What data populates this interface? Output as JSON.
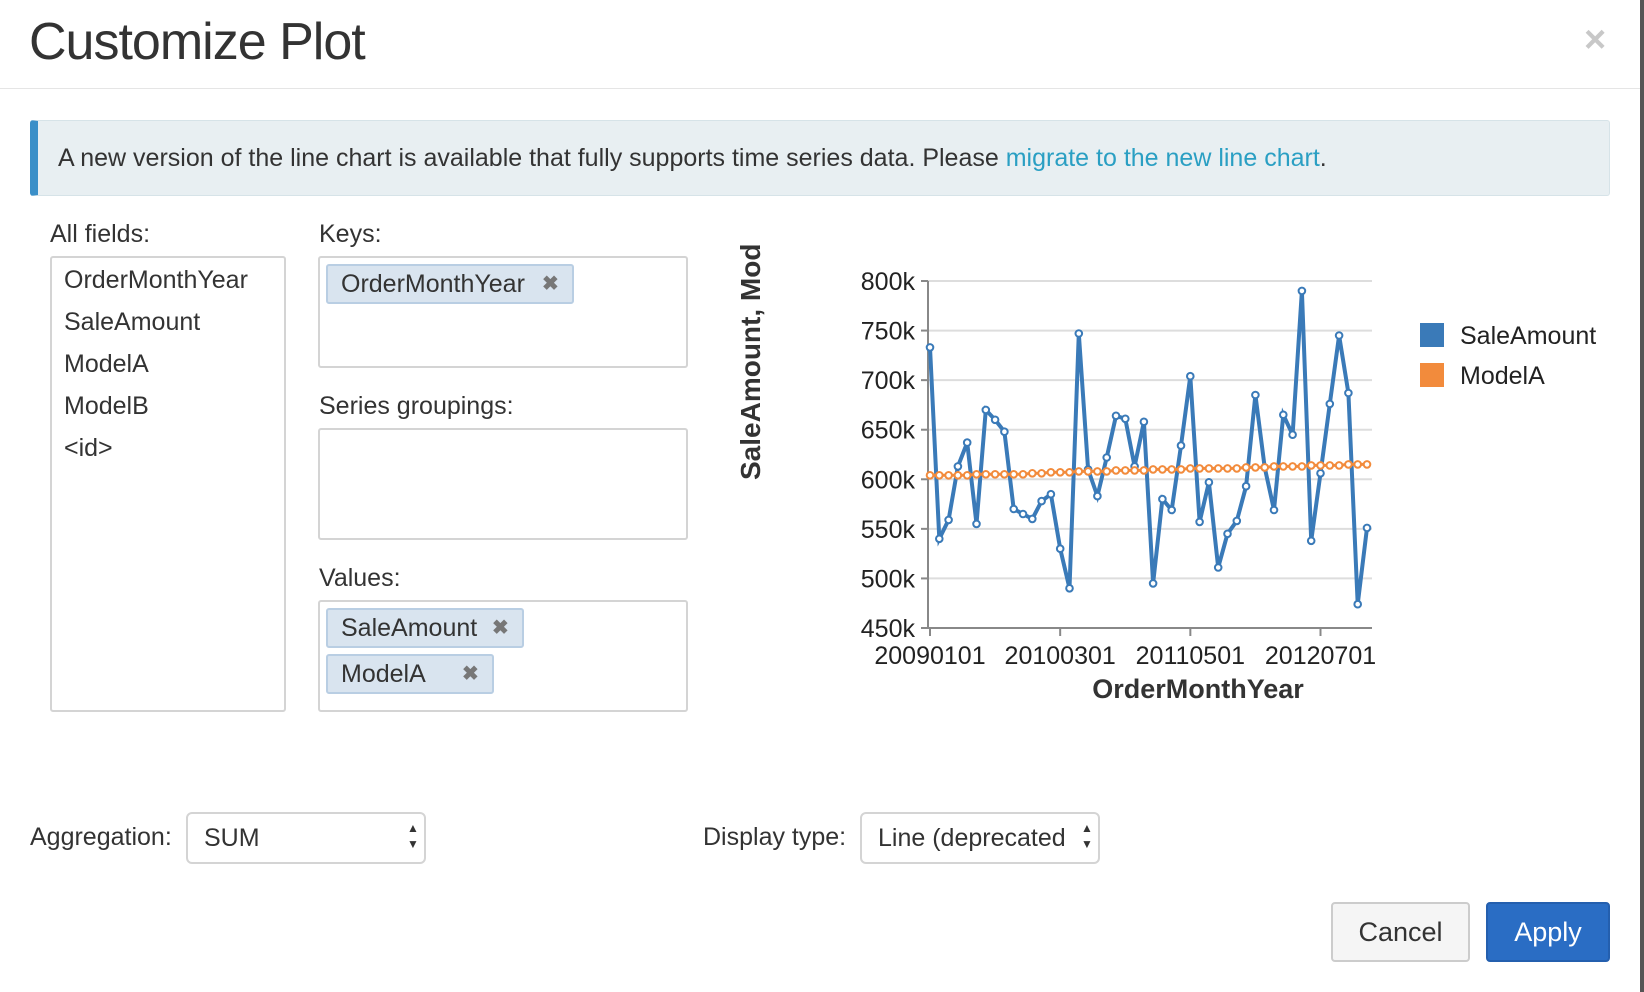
{
  "dialog": {
    "title": "Customize Plot",
    "close_glyph": "×"
  },
  "alert": {
    "text": "A new version of the line chart is available that fully supports time series data. Please ",
    "link": "migrate to the new line chart",
    "suffix": "."
  },
  "fields": {
    "label": "All fields:",
    "items": [
      "OrderMonthYear",
      "SaleAmount",
      "ModelA",
      "ModelB",
      "<id>"
    ]
  },
  "keys": {
    "label": "Keys:",
    "chips": [
      "OrderMonthYear"
    ]
  },
  "series_groupings": {
    "label": "Series groupings:"
  },
  "values": {
    "label": "Values:",
    "chips": [
      "SaleAmount",
      "ModelA"
    ]
  },
  "chip_remove_glyph": "✖",
  "aggregation": {
    "label": "Aggregation:",
    "value": "SUM"
  },
  "display_type": {
    "label": "Display type:",
    "value": "Line (deprecated"
  },
  "buttons": {
    "cancel": "Cancel",
    "apply": "Apply"
  },
  "colors": {
    "sale_amount": "#3a7ab8",
    "model_a": "#f28b3c",
    "apply": "#2a6dc4",
    "alert_bar": "#3b8fc8"
  },
  "chart_data": {
    "type": "line",
    "xlabel": "OrderMonthYear",
    "ylabel": "SaleAmount, Mod",
    "x_tick_labels": [
      "20090101",
      "20100301",
      "20110501",
      "20120701"
    ],
    "y_tick_labels": [
      "800k",
      "750k",
      "700k",
      "650k",
      "600k",
      "550k",
      "500k",
      "450k"
    ],
    "ylim": [
      450000,
      800000
    ],
    "grid": "horizontal",
    "legend_position": "right",
    "series": [
      {
        "name": "SaleAmount",
        "color": "#3a7ab8",
        "values": [
          733000,
          540000,
          559000,
          613000,
          637000,
          555000,
          670000,
          660000,
          648000,
          570000,
          565000,
          560000,
          578000,
          585000,
          530000,
          490000,
          747000,
          610000,
          583000,
          622000,
          664000,
          661000,
          613000,
          658000,
          495000,
          580000,
          569000,
          634000,
          704000,
          557000,
          597000,
          511000,
          545000,
          558000,
          593000,
          685000,
          612000,
          569000,
          665000,
          645000,
          790000,
          538000,
          606000,
          676000,
          745000,
          687000,
          474000,
          551000
        ]
      },
      {
        "name": "ModelA",
        "color": "#f28b3c",
        "values": [
          604000,
          604000,
          604000,
          604000,
          604000,
          605000,
          605000,
          605000,
          605000,
          605000,
          605000,
          606000,
          606000,
          607000,
          607000,
          607000,
          608000,
          608000,
          608000,
          608000,
          609000,
          609000,
          609000,
          609000,
          610000,
          610000,
          610000,
          610000,
          611000,
          611000,
          611000,
          611000,
          611000,
          611000,
          612000,
          612000,
          612000,
          613000,
          613000,
          613000,
          613000,
          614000,
          614000,
          614000,
          614000,
          615000,
          615000,
          615000
        ]
      }
    ]
  }
}
